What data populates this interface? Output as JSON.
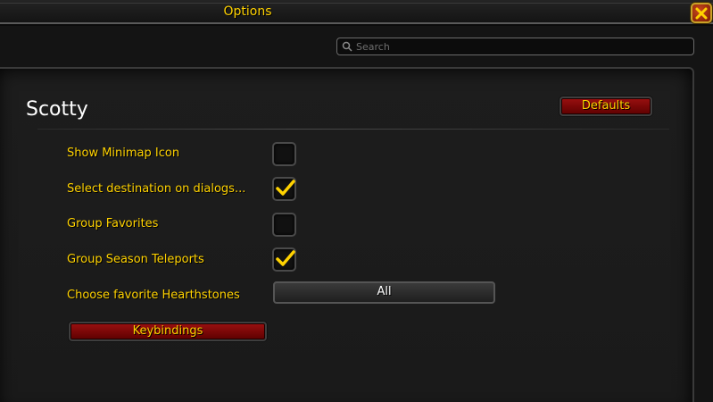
{
  "window": {
    "title": "Options",
    "close_icon": "close-icon"
  },
  "search": {
    "placeholder": "Search",
    "icon": "search-icon"
  },
  "panel": {
    "title": "Scotty",
    "defaults_label": "Defaults",
    "keybindings_label": "Keybindings"
  },
  "settings": [
    {
      "label": "Show Minimap Icon",
      "type": "checkbox",
      "checked": false
    },
    {
      "label": "Select destination on dialogs...",
      "type": "checkbox",
      "checked": true
    },
    {
      "label": "Group Favorites",
      "type": "checkbox",
      "checked": false
    },
    {
      "label": "Group Season Teleports",
      "type": "checkbox",
      "checked": true
    },
    {
      "label": "Choose favorite Hearthstones",
      "type": "dropdown",
      "value": "All"
    }
  ],
  "colors": {
    "accent": "#ffd200",
    "button_red": "#8b0000",
    "checkmark": "#ffd200"
  }
}
